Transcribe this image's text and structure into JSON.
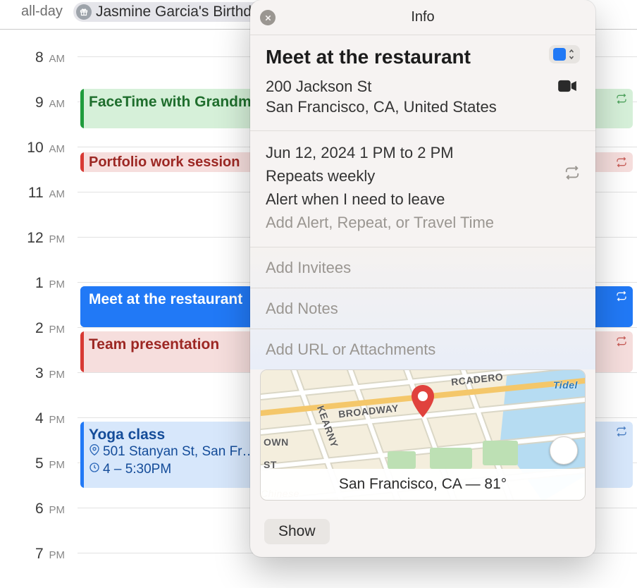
{
  "allday": {
    "label": "all-day",
    "event": "Jasmine Garcia's Birthday"
  },
  "hours": [
    {
      "num": "8",
      "ampm": "AM"
    },
    {
      "num": "9",
      "ampm": "AM"
    },
    {
      "num": "10",
      "ampm": "AM"
    },
    {
      "num": "11",
      "ampm": "AM"
    },
    {
      "num": "12",
      "ampm": "PM"
    },
    {
      "num": "1",
      "ampm": "PM"
    },
    {
      "num": "2",
      "ampm": "PM"
    },
    {
      "num": "3",
      "ampm": "PM"
    },
    {
      "num": "4",
      "ampm": "PM"
    },
    {
      "num": "5",
      "ampm": "PM"
    },
    {
      "num": "6",
      "ampm": "PM"
    },
    {
      "num": "7",
      "ampm": "PM"
    }
  ],
  "events": {
    "facetime": {
      "title": "FaceTime with Grandma"
    },
    "portfolio": {
      "title": "Portfolio work session"
    },
    "meet": {
      "title": "Meet at the restaurant"
    },
    "team": {
      "title": "Team presentation"
    },
    "yoga": {
      "title": "Yoga class",
      "location": "501 Stanyan St, San Fr…",
      "time": "4 – 5:30PM"
    }
  },
  "popover": {
    "header": "Info",
    "title": "Meet at the restaurant",
    "address_line1": "200 Jackson St",
    "address_line2": "San Francisco, CA, United States",
    "datetime": "Jun 12, 2024  1 PM to 2 PM",
    "repeat": "Repeats weekly",
    "alert": "Alert when I need to leave",
    "add_alert": "Add Alert, Repeat, or Travel Time",
    "add_invitees": "Add Invitees",
    "add_notes": "Add Notes",
    "add_url": "Add URL or Attachments",
    "map_caption": "San Francisco, CA — 81°",
    "map_labels": {
      "broadway": "BROADWAY",
      "kearny": "KEARNY",
      "rcadero": "RCADERO",
      "tidel": "Tidel",
      "own": "OWN",
      "st": "ST",
      "chinese": "Chinese"
    },
    "show": "Show"
  }
}
